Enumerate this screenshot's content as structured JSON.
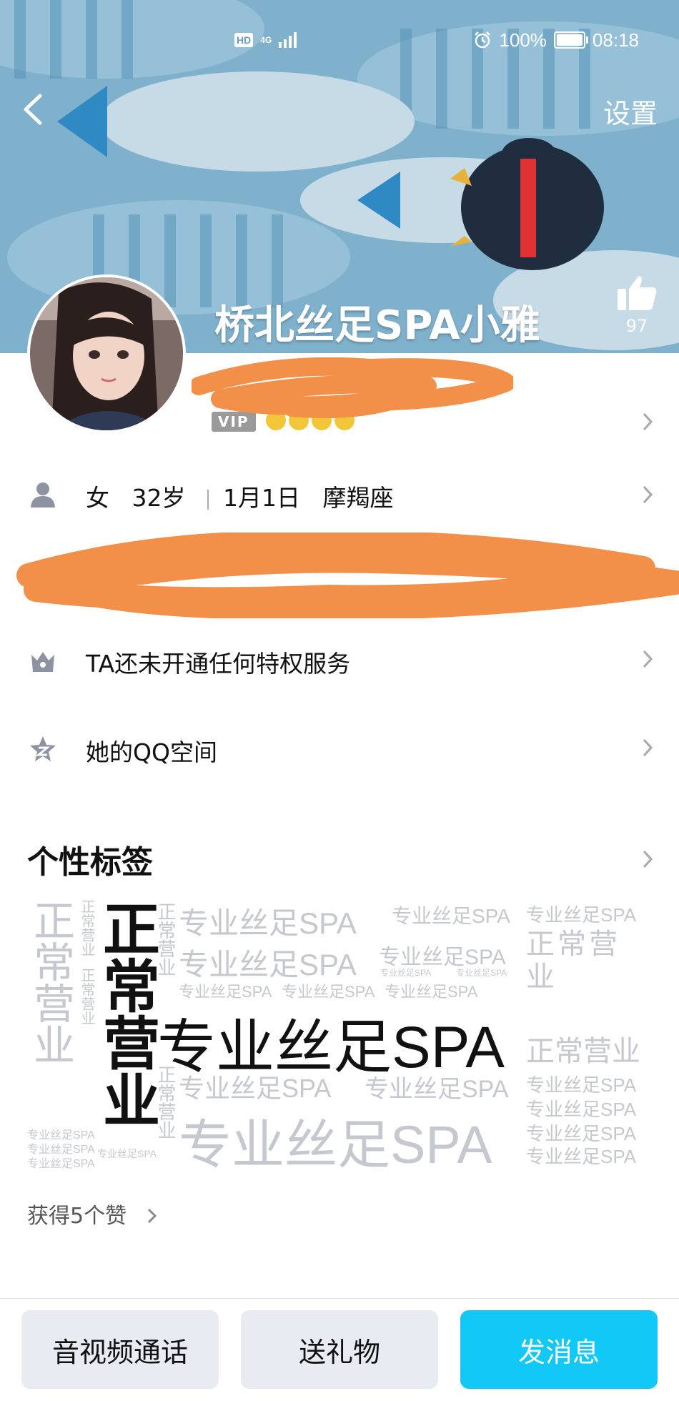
{
  "status_bar": {
    "network": "4G",
    "hd": "HD",
    "battery": "100%",
    "time": "08:18"
  },
  "header": {
    "back_icon": "chevron-left-icon",
    "settings_label": "设置",
    "name": "桥北丝足SPA小雅",
    "like_count": "97"
  },
  "profile": {
    "vip_label": "VIP"
  },
  "info": {
    "gender": "女",
    "age": "32岁",
    "birthday": "1月1日",
    "zodiac": "摩羯座",
    "privilege": "TA还未开通任何特权服务",
    "qzone": "她的QQ空间"
  },
  "tags": {
    "title": "个性标签",
    "main_tag": "专业丝足SPA",
    "status_tag": "正常营业",
    "likes_got": "获得5个赞"
  },
  "actions": {
    "call": "音视频通话",
    "gift": "送礼物",
    "message": "发消息"
  },
  "colors": {
    "accent": "#12c8f7",
    "scribble": "#f2904a",
    "header_bg": "#7fb0cc"
  }
}
